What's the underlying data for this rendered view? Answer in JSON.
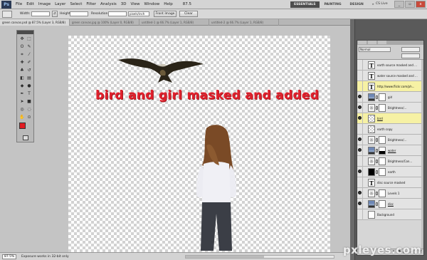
{
  "menubar": {
    "items": [
      "File",
      "Edit",
      "Image",
      "Layer",
      "Select",
      "Filter",
      "Analysis",
      "3D",
      "View",
      "Window",
      "Help"
    ],
    "zoom": "87.5",
    "workspaces": [
      "ESSENTIALS",
      "PAINTING",
      "DESIGN"
    ],
    "more": "»",
    "cs_live": "CS Live",
    "win_controls": [
      "_",
      "▫",
      "x"
    ]
  },
  "options": {
    "width_label": "Width:",
    "height_label": "Height:",
    "resolution_label": "Resolution:",
    "res_unit": "pixels/inch",
    "front_image": "Front Image",
    "clear": "Clear"
  },
  "tabs": [
    "green canvas.psd @ 87.5% (Layer 3, RGB/8)",
    "green canvas.jpg @ 100% (Layer 0, RGB/8)",
    "untitled-1 @ 66.7% (Layer 1, RGB/8)",
    "untitled-2 @ 66.7% (Layer 1, RGB/8)"
  ],
  "canvas": {
    "caption": "bird and girl masked and added"
  },
  "status": {
    "zoom": "87.5%",
    "text": "Exposure works in 32-bit only"
  },
  "layers": {
    "blend_mode": "Normal",
    "items": [
      {
        "name": "earth source masked and ...",
        "thumb": "text",
        "yellow": false,
        "visible": false,
        "underline": false
      },
      {
        "name": "water source masked and ...",
        "thumb": "text",
        "yellow": false,
        "visible": false,
        "underline": false
      },
      {
        "name": "http://www.flickr.com/ph...",
        "thumb": "text",
        "yellow": true,
        "visible": false,
        "underline": false
      },
      {
        "name": "girl",
        "thumb": "photo",
        "yellow": false,
        "visible": true,
        "underline": false
      },
      {
        "name": "Brightness/...",
        "thumb": "adj",
        "yellow": false,
        "visible": true,
        "underline": false
      },
      {
        "name": "bird",
        "thumb": "checker",
        "yellow": true,
        "visible": true,
        "underline": true
      },
      {
        "name": "earth copy",
        "thumb": "checker",
        "yellow": false,
        "visible": false,
        "underline": false
      },
      {
        "name": "Brightness/...",
        "thumb": "adj",
        "yellow": false,
        "visible": true,
        "underline": false
      },
      {
        "name": "water",
        "thumb": "halfmask",
        "yellow": false,
        "visible": true,
        "underline": true
      },
      {
        "name": "Brightness/Con...",
        "thumb": "adj",
        "yellow": false,
        "visible": false,
        "underline": false
      },
      {
        "name": "earth",
        "thumb": "black",
        "yellow": false,
        "visible": true,
        "underline": false
      },
      {
        "name": "disc source masked",
        "thumb": "text",
        "yellow": false,
        "visible": false,
        "underline": false
      },
      {
        "name": "Levels 1",
        "thumb": "adj",
        "yellow": false,
        "visible": true,
        "underline": false
      },
      {
        "name": "disc",
        "thumb": "photo",
        "yellow": false,
        "visible": true,
        "underline": true
      },
      {
        "name": "Background",
        "thumb": "white",
        "yellow": false,
        "visible": false,
        "underline": false
      }
    ]
  },
  "watermark": "pxleyes.com"
}
